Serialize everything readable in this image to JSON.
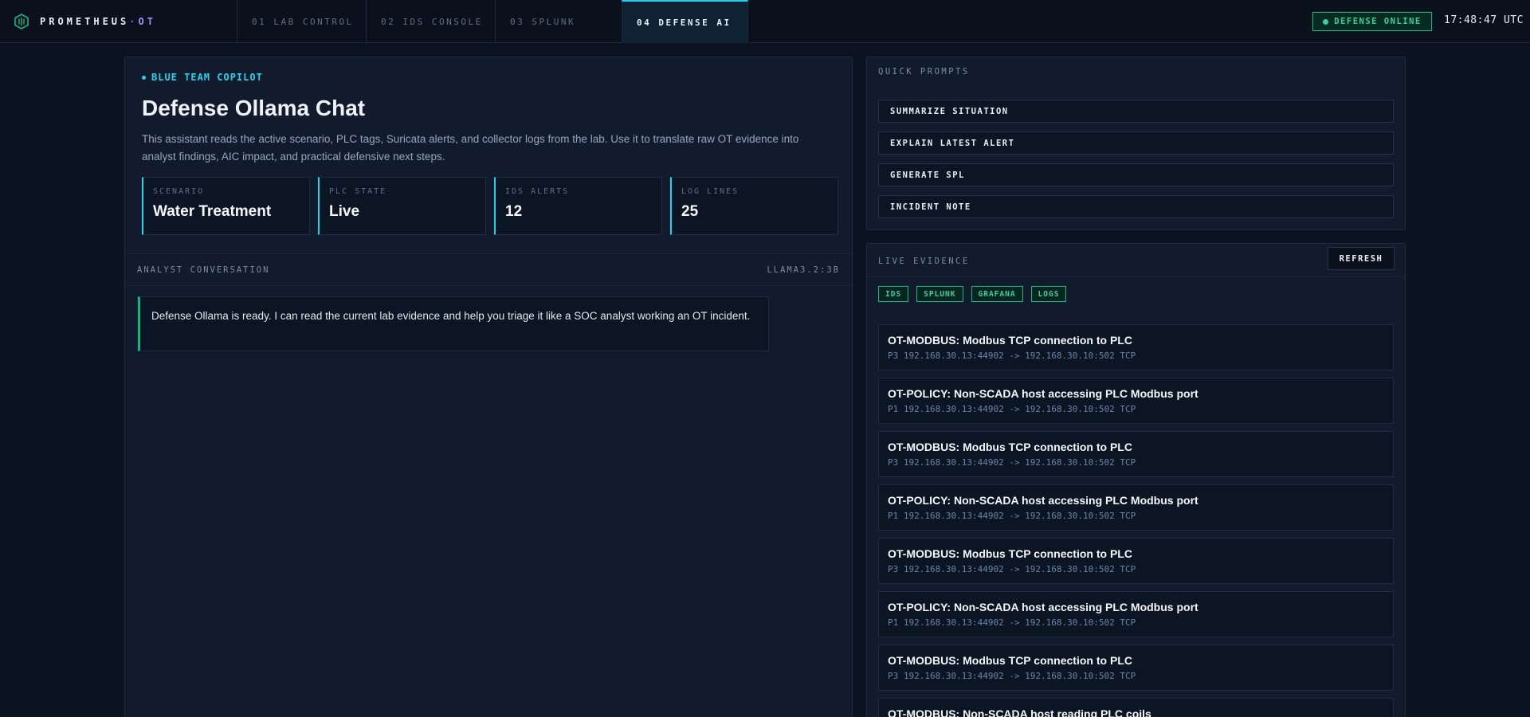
{
  "brand": {
    "name": "PROMETHEUS",
    "separator": "·",
    "suffix": "OT",
    "icon": "shield-hex-icon"
  },
  "tabs": [
    {
      "label": "01 LAB CONTROL",
      "active": false
    },
    {
      "label": "02 IDS CONSOLE",
      "active": false
    },
    {
      "label": "03 SPLUNK",
      "active": false
    },
    {
      "label": "04 DEFENSE AI",
      "active": true
    }
  ],
  "status": {
    "label": "DEFENSE ONLINE",
    "color": "#34d399"
  },
  "clock": "17:48:47 UTC",
  "chat": {
    "eyebrow": "BLUE TEAM COPILOT",
    "title": "Defense Ollama Chat",
    "description": "This assistant reads the active scenario, PLC tags, Suricata alerts, and collector logs from the lab. Use it to translate raw OT evidence into analyst findings, AIC impact, and practical defensive next steps.",
    "stats": [
      {
        "label": "SCENARIO",
        "value": "Water Treatment"
      },
      {
        "label": "PLC STATE",
        "value": "Live"
      },
      {
        "label": "IDS ALERTS",
        "value": "12"
      },
      {
        "label": "LOG LINES",
        "value": "25"
      }
    ],
    "conversation_label": "ANALYST CONVERSATION",
    "model": "LLAMA3.2:3B",
    "messages": [
      "Defense Ollama is ready. I can read the current lab evidence and help you triage it like a SOC analyst working an OT incident."
    ]
  },
  "quick_prompts": {
    "label": "QUICK PROMPTS",
    "items": [
      "SUMMARIZE SITUATION",
      "EXPLAIN LATEST ALERT",
      "GENERATE SPL",
      "INCIDENT NOTE"
    ]
  },
  "evidence": {
    "label": "LIVE EVIDENCE",
    "refresh_label": "REFRESH",
    "chips": [
      "IDS",
      "SPLUNK",
      "GRAFANA",
      "LOGS"
    ],
    "items": [
      {
        "title": "OT-MODBUS: Modbus TCP connection to PLC",
        "meta": "P3 192.168.30.13:44902 -> 192.168.30.10:502 TCP"
      },
      {
        "title": "OT-POLICY: Non-SCADA host accessing PLC Modbus port",
        "meta": "P1 192.168.30.13:44902 -> 192.168.30.10:502 TCP"
      },
      {
        "title": "OT-MODBUS: Modbus TCP connection to PLC",
        "meta": "P3 192.168.30.13:44902 -> 192.168.30.10:502 TCP"
      },
      {
        "title": "OT-POLICY: Non-SCADA host accessing PLC Modbus port",
        "meta": "P1 192.168.30.13:44902 -> 192.168.30.10:502 TCP"
      },
      {
        "title": "OT-MODBUS: Modbus TCP connection to PLC",
        "meta": "P3 192.168.30.13:44902 -> 192.168.30.10:502 TCP"
      },
      {
        "title": "OT-POLICY: Non-SCADA host accessing PLC Modbus port",
        "meta": "P1 192.168.30.13:44902 -> 192.168.30.10:502 TCP"
      },
      {
        "title": "OT-MODBUS: Modbus TCP connection to PLC",
        "meta": "P3 192.168.30.13:44902 -> 192.168.30.10:502 TCP"
      },
      {
        "title": "OT-MODBUS: Non-SCADA host reading PLC coils",
        "meta": ""
      }
    ]
  }
}
